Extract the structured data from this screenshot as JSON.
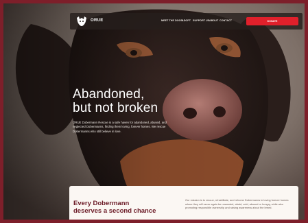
{
  "brand": {
    "name": "ORUE"
  },
  "nav": {
    "items": [
      "MEET THE DOGS",
      "ADOPT",
      "SUPPORT US",
      "ABOUT",
      "CONTACT"
    ],
    "cta_label": "DONATE"
  },
  "hero": {
    "headline_line1": "Abandoned,",
    "headline_line2": "but not broken",
    "intro": "ORUE Dobermann Rescue is a safe haven for abandoned, abused, and neglected Dobermanns, finding them loving, forever homes. We rescue Dobermanns who still believe in love."
  },
  "card": {
    "title_line1": "Every Dobermann",
    "title_line2": "deserves a second chance",
    "text": "Our mission is to rescue, rehabilitate, and rehome Dobermanns in loving forever homes where they will never again be unwanted, afraid, cold, abused or hungry, while also promoting responsible ownership and raising awareness about the breed."
  },
  "colors": {
    "frame": "#7d1f2a",
    "accent": "#e0202b",
    "card_bg": "#fbf7f3",
    "title": "#6b1a26"
  },
  "icons": {
    "logo": "dog-paw-logo-icon"
  }
}
